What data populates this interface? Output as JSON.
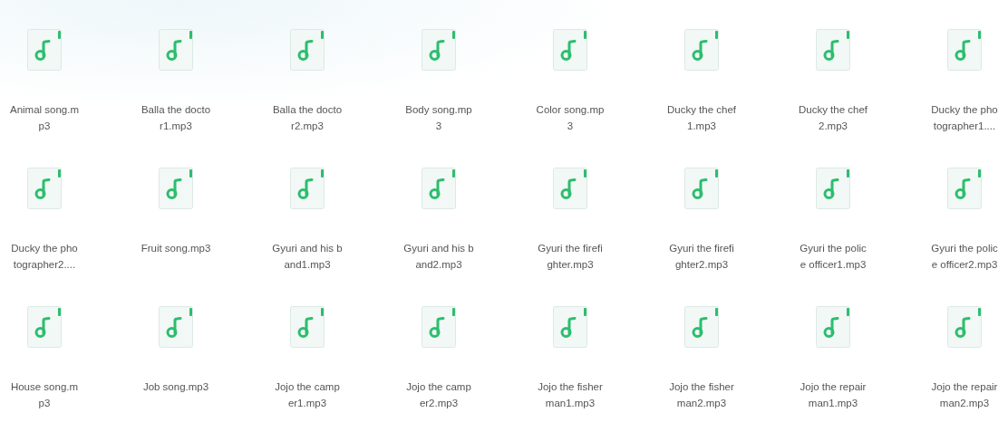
{
  "files": [
    {
      "lines": [
        "Animal song.m",
        "p3"
      ]
    },
    {
      "lines": [
        "Balla the docto",
        "r1.mp3"
      ]
    },
    {
      "lines": [
        "Balla the docto",
        "r2.mp3"
      ]
    },
    {
      "lines": [
        "Body song.mp",
        "3"
      ]
    },
    {
      "lines": [
        "Color song.mp",
        "3"
      ]
    },
    {
      "lines": [
        "Ducky the chef",
        "1.mp3"
      ]
    },
    {
      "lines": [
        "Ducky the chef",
        "2.mp3"
      ]
    },
    {
      "lines": [
        "Ducky the pho",
        "tographer1...."
      ]
    },
    {
      "lines": [
        "Ducky the pho",
        "tographer2...."
      ]
    },
    {
      "lines": [
        "Fruit song.mp3"
      ]
    },
    {
      "lines": [
        "Gyuri and his b",
        "and1.mp3"
      ]
    },
    {
      "lines": [
        "Gyuri and his b",
        "and2.mp3"
      ]
    },
    {
      "lines": [
        "Gyuri the firefi",
        "ghter.mp3"
      ]
    },
    {
      "lines": [
        "Gyuri the firefi",
        "ghter2.mp3"
      ]
    },
    {
      "lines": [
        "Gyuri the polic",
        "e officer1.mp3"
      ]
    },
    {
      "lines": [
        "Gyuri the polic",
        "e officer2.mp3"
      ]
    },
    {
      "lines": [
        "House song.m",
        "p3"
      ]
    },
    {
      "lines": [
        "Job song.mp3"
      ]
    },
    {
      "lines": [
        "Jojo the camp",
        "er1.mp3"
      ]
    },
    {
      "lines": [
        "Jojo the camp",
        "er2.mp3"
      ]
    },
    {
      "lines": [
        "Jojo the fisher",
        "man1.mp3"
      ]
    },
    {
      "lines": [
        "Jojo the fisher",
        "man2.mp3"
      ]
    },
    {
      "lines": [
        "Jojo the repair",
        "man1.mp3"
      ]
    },
    {
      "lines": [
        "Jojo the repair",
        "man2.mp3"
      ]
    }
  ]
}
